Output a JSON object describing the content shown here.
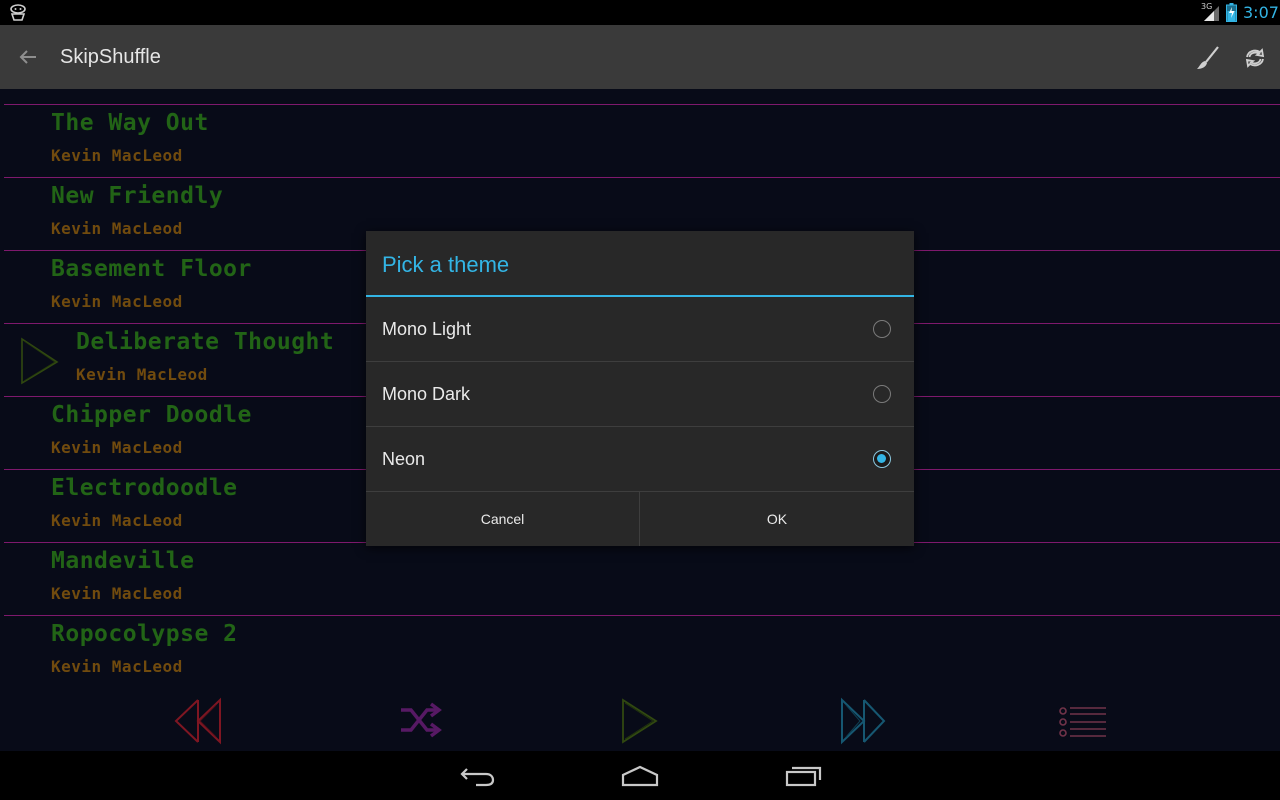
{
  "status_bar": {
    "time": "3:07",
    "network_type": "3G",
    "icons": [
      "android-notification-icon",
      "signal-icon",
      "battery-icon"
    ]
  },
  "action_bar": {
    "title": "SkipShuffle",
    "icons": [
      "back-arrow-icon",
      "brush-icon",
      "sync-icon"
    ]
  },
  "playlist": {
    "songs": [
      {
        "title": "The Way Out",
        "artist": "Kevin MacLeod"
      },
      {
        "title": "New Friendly",
        "artist": "Kevin MacLeod"
      },
      {
        "title": "Basement Floor",
        "artist": "Kevin MacLeod"
      },
      {
        "title": "Deliberate Thought",
        "artist": "Kevin MacLeod",
        "playing": true
      },
      {
        "title": "Chipper Doodle",
        "artist": "Kevin MacLeod"
      },
      {
        "title": "Electrodoodle",
        "artist": "Kevin MacLeod"
      },
      {
        "title": "Mandeville",
        "artist": "Kevin MacLeod"
      },
      {
        "title": "Ropocolypse 2",
        "artist": "Kevin MacLeod"
      }
    ]
  },
  "controls": {
    "icons": [
      "skip-back-icon",
      "shuffle-icon",
      "play-icon",
      "skip-forward-icon",
      "playlist-icon"
    ],
    "colors": {
      "skip_back": "#9c1b2a",
      "shuffle": "#6b1f7a",
      "play": "#3c5a14",
      "skip_forward": "#1b6b8a",
      "playlist": "#8a3f5a"
    }
  },
  "theme_dialog": {
    "title": "Pick a theme",
    "options": [
      {
        "label": "Mono Light",
        "checked": false
      },
      {
        "label": "Mono Dark",
        "checked": false
      },
      {
        "label": "Neon",
        "checked": true
      }
    ],
    "cancel_label": "Cancel",
    "ok_label": "OK"
  },
  "nav_bar": {
    "icons": [
      "nav-back-icon",
      "nav-home-icon",
      "nav-recents-icon"
    ]
  },
  "colors": {
    "accent": "#33b5e5",
    "song_title": "#2a7a1c",
    "song_artist": "#8a5c12",
    "divider": "#9a1f86",
    "background": "#0a0e1e"
  }
}
